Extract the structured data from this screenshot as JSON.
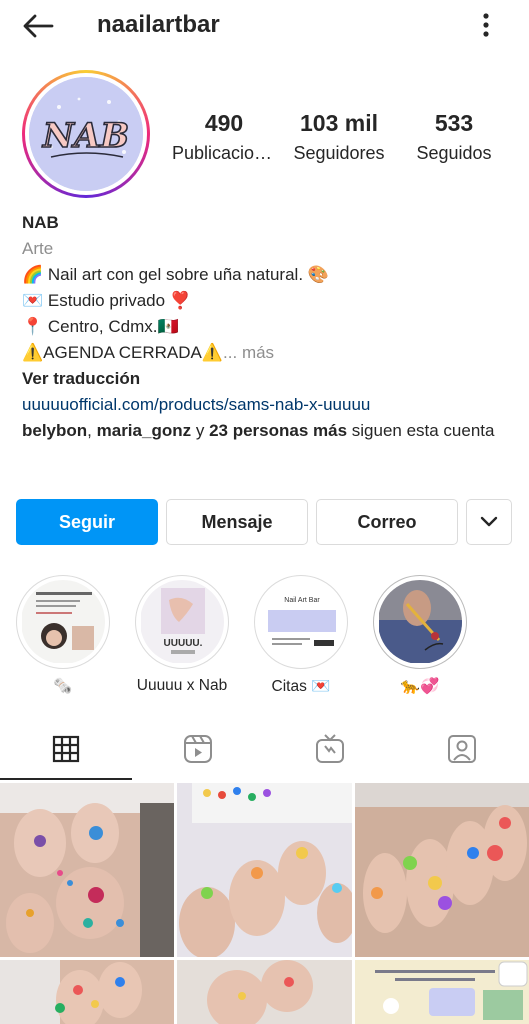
{
  "header": {
    "username": "naailartbar"
  },
  "profile": {
    "stats": {
      "posts_count": "490",
      "posts_label": "Publicaciones",
      "followers_count": "103 mil",
      "followers_label": "Seguidores",
      "following_count": "533",
      "following_label": "Seguidos"
    },
    "avatar_text": "NAB"
  },
  "bio": {
    "name": "NAB",
    "category": "Arte",
    "lines": [
      "🌈 Nail art con gel sobre uña natural. 🎨",
      "💌 Estudio privado ❣️",
      "📍 Centro, Cdmx.🇲🇽",
      "⚠️AGENDA CERRADA⚠️"
    ],
    "more_label": "... más",
    "translate_label": "Ver traducción",
    "link": "uuuuuofficial.com/products/sams-nab-x-uuuuu",
    "followed_by_user1": "belybon",
    "followed_by_sep": ", ",
    "followed_by_user2": "maria_gonz",
    "followed_by_mid": " y ",
    "followed_by_others": "23 personas más",
    "followed_by_tail": " siguen esta cuenta"
  },
  "actions": {
    "follow_label": "Seguir",
    "message_label": "Mensaje",
    "email_label": "Correo"
  },
  "highlights": [
    {
      "label": "🗞️"
    },
    {
      "label": "Uuuuu x Nab"
    },
    {
      "label": "Citas 💌"
    },
    {
      "label": "🐆💞"
    }
  ],
  "highlight_texts": {
    "card_title": "Nail Art Bar",
    "tag": "UUUUU."
  },
  "tabs": [
    {
      "icon": "grid-icon",
      "active": true
    },
    {
      "icon": "reels-icon",
      "active": false
    },
    {
      "icon": "igtv-icon",
      "active": false
    },
    {
      "icon": "tagged-icon",
      "active": false
    }
  ],
  "colors": {
    "accent": "#0095f6",
    "link": "#00376b",
    "muted": "#8e8e8e",
    "border": "#dbdbdb"
  }
}
